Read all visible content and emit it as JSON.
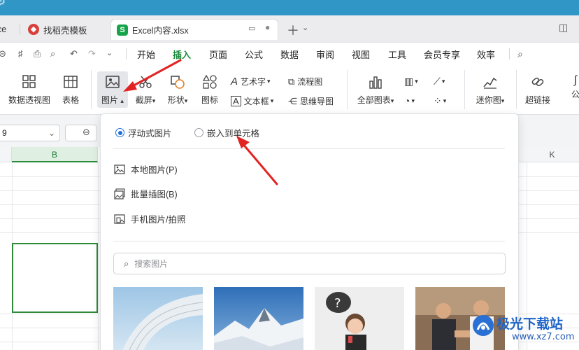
{
  "window": {
    "accent": "#2f96c6"
  },
  "tabs": [
    {
      "label": "ce",
      "icon": "none",
      "state": "inactive"
    },
    {
      "label": "找稻壳模板",
      "icon": "docer-icon",
      "state": "inactive",
      "color": "#d8413b"
    },
    {
      "label": "Excel内容.xlsx",
      "icon": "spreadsheet-icon",
      "icon_text": "S",
      "state": "active",
      "color": "#17a34a"
    }
  ],
  "menu": {
    "items": [
      "开始",
      "插入",
      "页面",
      "公式",
      "数据",
      "审阅",
      "视图",
      "工具",
      "会员专享",
      "效率"
    ],
    "active": "插入",
    "active_color": "#1c8a3c"
  },
  "ribbon": {
    "pivot_table": "数据透视图",
    "table": "表格",
    "picture": "图片",
    "screenshot": "截屏",
    "shape": "形状",
    "icon_lib": "图标",
    "art_text": "艺术字",
    "text_box": "文本框",
    "flowchart": "流程图",
    "mind_map": "思维导图",
    "all_charts": "全部图表",
    "sparkline": "迷你图",
    "hyperlink": "超链接",
    "formula_partial": "公"
  },
  "formula_bar": {
    "name_box": "9"
  },
  "grid": {
    "columns": [
      "B",
      "K"
    ],
    "selected_column": "B"
  },
  "picture_menu": {
    "radio_floating": "浮动式图片",
    "radio_embed": "嵌入到单元格",
    "selected_radio": "floating",
    "local_picture": "本地图片(P)",
    "batch_insert": "批量插图(B)",
    "phone_picture": "手机图片/拍照",
    "search_placeholder": "搜索图片"
  },
  "watermark": {
    "title": "极光下载站",
    "url": "www.xz7.com"
  }
}
